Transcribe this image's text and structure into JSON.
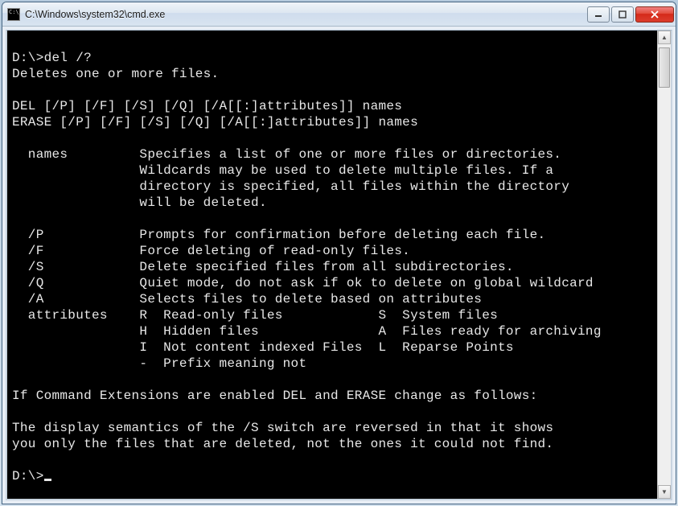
{
  "window": {
    "title": "C:\\Windows\\system32\\cmd.exe"
  },
  "terminal": {
    "prompt1": "D:\\>",
    "command1": "del /?",
    "lines": [
      "Deletes one or more files.",
      "",
      "DEL [/P] [/F] [/S] [/Q] [/A[[:]attributes]] names",
      "ERASE [/P] [/F] [/S] [/Q] [/A[[:]attributes]] names",
      "",
      "  names         Specifies a list of one or more files or directories.",
      "                Wildcards may be used to delete multiple files. If a",
      "                directory is specified, all files within the directory",
      "                will be deleted.",
      "",
      "  /P            Prompts for confirmation before deleting each file.",
      "  /F            Force deleting of read-only files.",
      "  /S            Delete specified files from all subdirectories.",
      "  /Q            Quiet mode, do not ask if ok to delete on global wildcard",
      "  /A            Selects files to delete based on attributes",
      "  attributes    R  Read-only files            S  System files",
      "                H  Hidden files               A  Files ready for archiving",
      "                I  Not content indexed Files  L  Reparse Points",
      "                -  Prefix meaning not",
      "",
      "If Command Extensions are enabled DEL and ERASE change as follows:",
      "",
      "The display semantics of the /S switch are reversed in that it shows",
      "you only the files that are deleted, not the ones it could not find.",
      ""
    ],
    "prompt2": "D:\\>"
  }
}
